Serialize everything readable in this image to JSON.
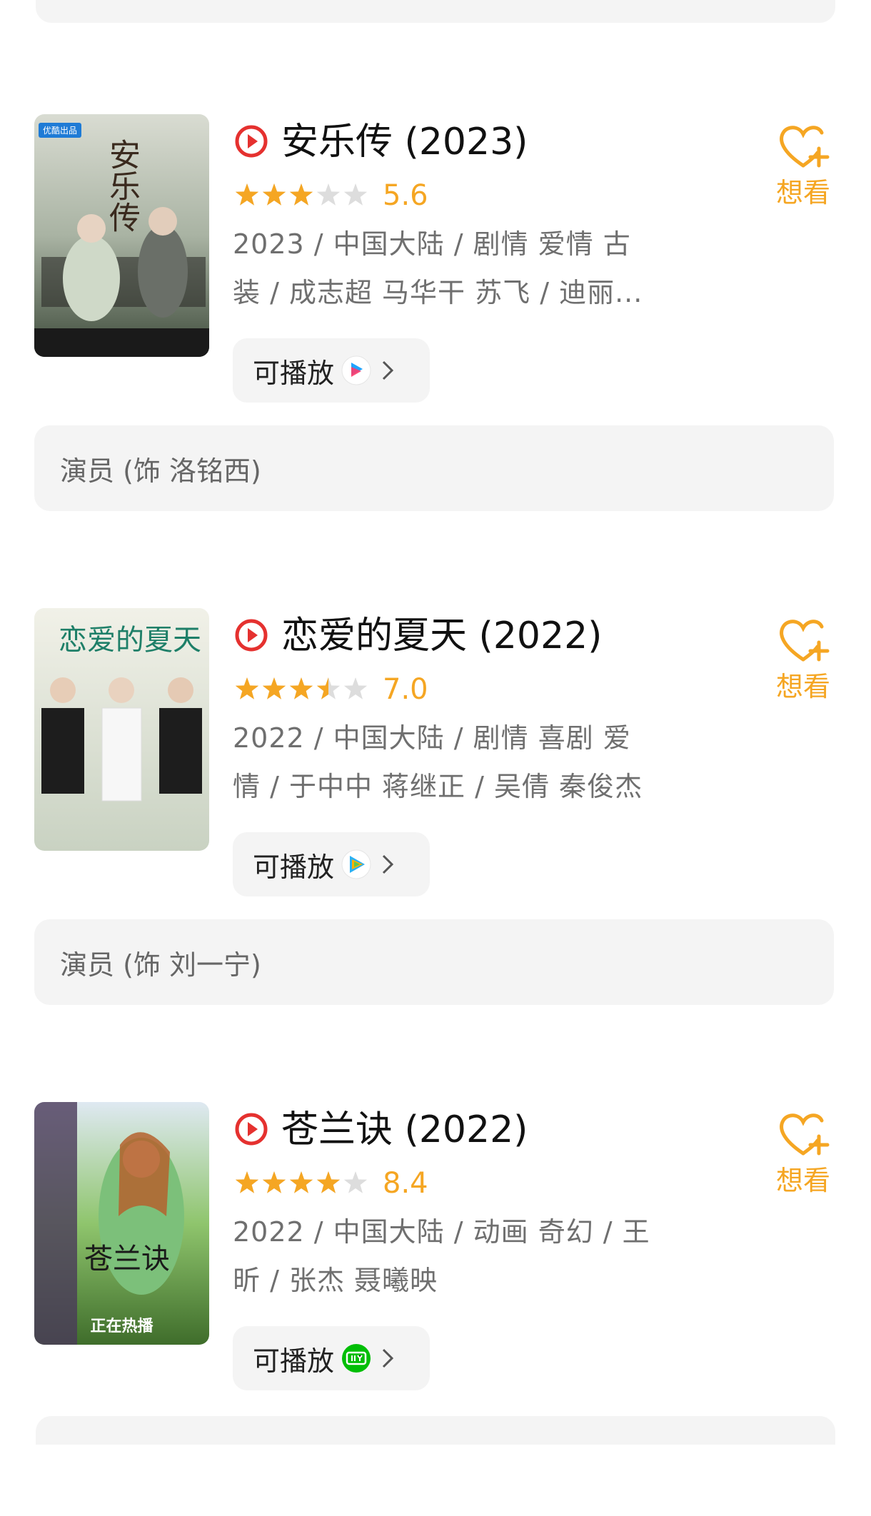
{
  "entries": [
    {
      "title": "安乐传 (2023)",
      "rating": 5.6,
      "stars": 3,
      "score": "5.6",
      "info_line1": "2023 / 中国大陆 / 剧情 爱情 古",
      "info_line2": "装 / 成志超 马华干 苏飞 / 迪丽...",
      "play_label": "可播放",
      "platform": "youku-icon",
      "want_label": "想看",
      "role": "演员 (饰 洛铭西)",
      "poster_text": "安乐传",
      "poster_badge": "优酷出品",
      "poster_foot": ""
    },
    {
      "title": "恋爱的夏天 (2022)",
      "rating": 7.0,
      "stars": 3.5,
      "score": "7.0",
      "info_line1": "2022 / 中国大陆 / 剧情 喜剧 爱",
      "info_line2": "情 / 于中中 蒋继正 / 吴倩 秦俊杰",
      "play_label": "可播放",
      "platform": "tencent-video-icon",
      "want_label": "想看",
      "role": "演员 (饰 刘一宁)",
      "poster_text": "恋爱的夏天",
      "poster_badge": "",
      "poster_foot": ""
    },
    {
      "title": "苍兰诀 (2022)",
      "rating": 8.4,
      "stars": 4,
      "score": "8.4",
      "info_line1": "2022 / 中国大陆 / 动画 奇幻 / 王",
      "info_line2": "昕 / 张杰 聂曦映",
      "play_label": "可播放",
      "platform": "iqiyi-icon",
      "want_label": "想看",
      "role": "",
      "poster_text": "苍兰诀",
      "poster_badge": "",
      "poster_foot": "正在热播"
    }
  ],
  "colors": {
    "accent": "#f5a623",
    "play_red": "#e5312f",
    "star_empty": "#dddddd",
    "card_bg": "#f4f4f4"
  }
}
